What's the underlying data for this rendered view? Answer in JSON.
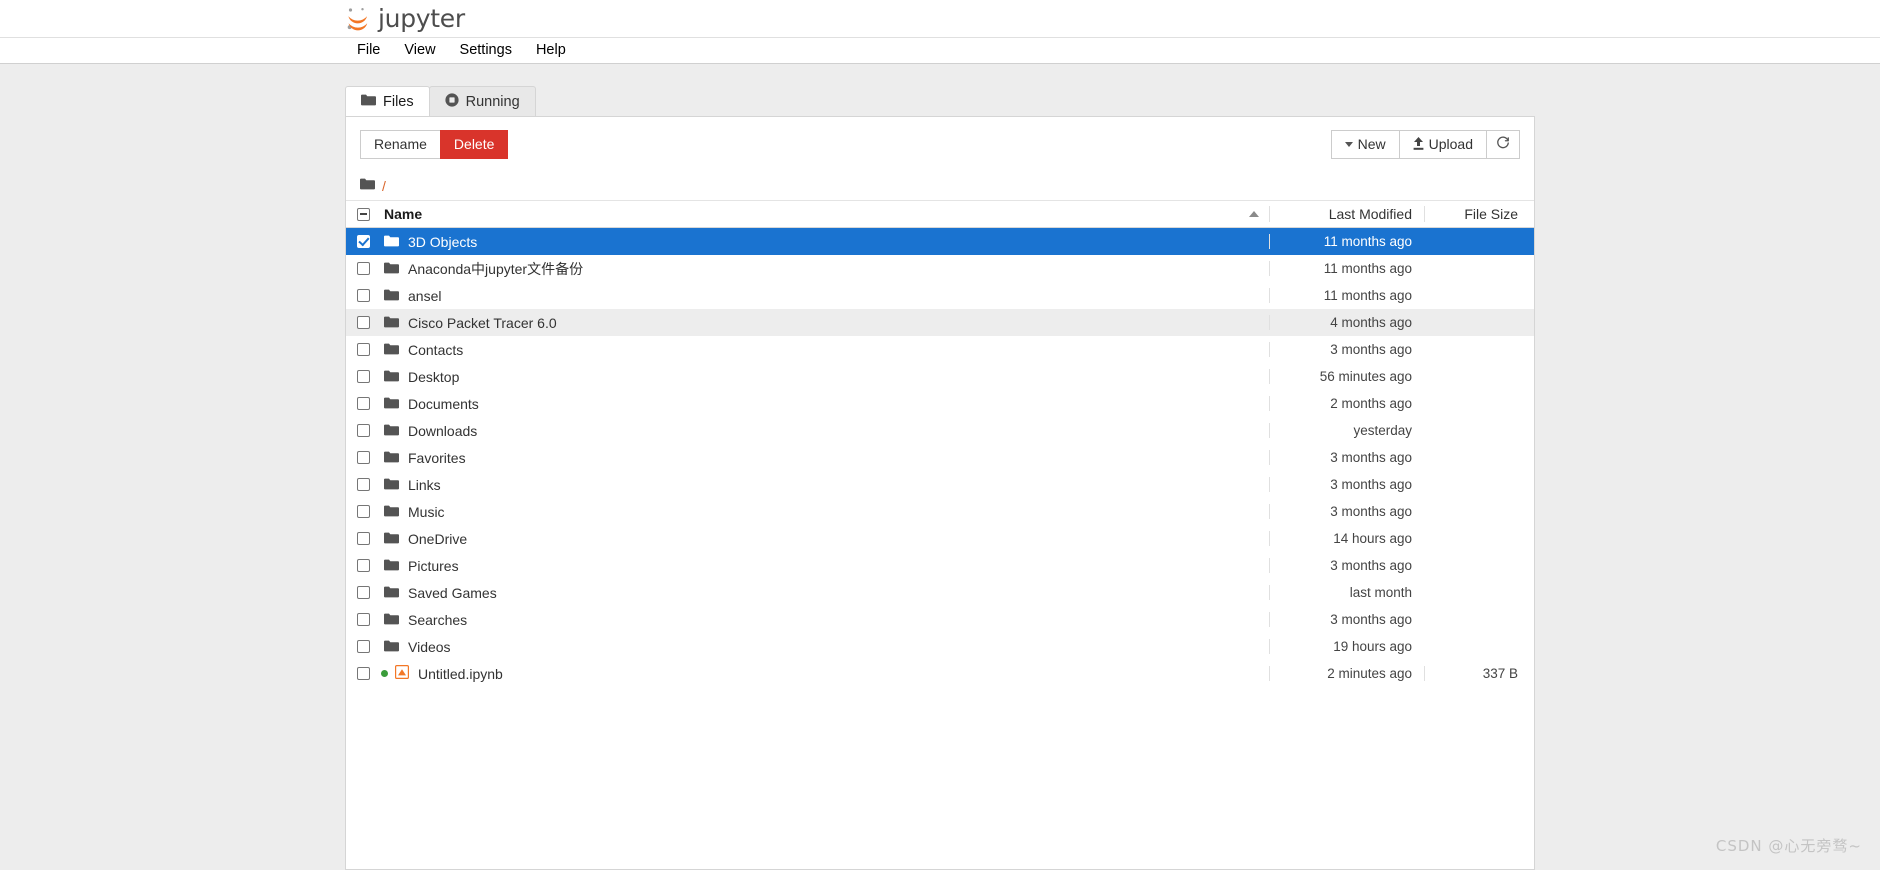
{
  "brand": {
    "name": "jupyter",
    "logo_icon": "jupyter-logo-icon",
    "accent_color": "#f37726"
  },
  "menu": {
    "items": [
      {
        "label": "File"
      },
      {
        "label": "View"
      },
      {
        "label": "Settings"
      },
      {
        "label": "Help"
      }
    ]
  },
  "tabs": [
    {
      "label": "Files",
      "icon": "folder-icon",
      "active": true
    },
    {
      "label": "Running",
      "icon": "running-stop-icon",
      "active": false
    }
  ],
  "toolbar": {
    "rename_label": "Rename",
    "delete_label": "Delete",
    "new_label": "New",
    "upload_label": "Upload",
    "refresh_icon": "refresh-icon",
    "new_caret_icon": "chevron-down-icon",
    "upload_icon": "upload-arrow-icon",
    "delete_color": "#d9342b"
  },
  "breadcrumb": {
    "icon": "folder-icon",
    "path": "/"
  },
  "table": {
    "headers": {
      "name": "Name",
      "last_modified": "Last Modified",
      "file_size": "File Size"
    },
    "sort_icon": "sort-ascending-icon",
    "select_all_state": "indeterminate",
    "selection_color": "#1a73d0",
    "rows": [
      {
        "name": "3D Objects",
        "icon": "folder-icon",
        "modified": "11 months ago",
        "size": "",
        "selected": true,
        "alt": false,
        "running": false
      },
      {
        "name": "Anaconda中jupyter文件备份",
        "icon": "folder-icon",
        "modified": "11 months ago",
        "size": "",
        "selected": false,
        "alt": false,
        "running": false
      },
      {
        "name": "ansel",
        "icon": "folder-icon",
        "modified": "11 months ago",
        "size": "",
        "selected": false,
        "alt": false,
        "running": false
      },
      {
        "name": "Cisco Packet Tracer 6.0",
        "icon": "folder-icon",
        "modified": "4 months ago",
        "size": "",
        "selected": false,
        "alt": true,
        "running": false
      },
      {
        "name": "Contacts",
        "icon": "folder-icon",
        "modified": "3 months ago",
        "size": "",
        "selected": false,
        "alt": false,
        "running": false
      },
      {
        "name": "Desktop",
        "icon": "folder-icon",
        "modified": "56 minutes ago",
        "size": "",
        "selected": false,
        "alt": false,
        "running": false
      },
      {
        "name": "Documents",
        "icon": "folder-icon",
        "modified": "2 months ago",
        "size": "",
        "selected": false,
        "alt": false,
        "running": false
      },
      {
        "name": "Downloads",
        "icon": "folder-icon",
        "modified": "yesterday",
        "size": "",
        "selected": false,
        "alt": false,
        "running": false
      },
      {
        "name": "Favorites",
        "icon": "folder-icon",
        "modified": "3 months ago",
        "size": "",
        "selected": false,
        "alt": false,
        "running": false
      },
      {
        "name": "Links",
        "icon": "folder-icon",
        "modified": "3 months ago",
        "size": "",
        "selected": false,
        "alt": false,
        "running": false
      },
      {
        "name": "Music",
        "icon": "folder-icon",
        "modified": "3 months ago",
        "size": "",
        "selected": false,
        "alt": false,
        "running": false
      },
      {
        "name": "OneDrive",
        "icon": "folder-icon",
        "modified": "14 hours ago",
        "size": "",
        "selected": false,
        "alt": false,
        "running": false
      },
      {
        "name": "Pictures",
        "icon": "folder-icon",
        "modified": "3 months ago",
        "size": "",
        "selected": false,
        "alt": false,
        "running": false
      },
      {
        "name": "Saved Games",
        "icon": "folder-icon",
        "modified": "last month",
        "size": "",
        "selected": false,
        "alt": false,
        "running": false
      },
      {
        "name": "Searches",
        "icon": "folder-icon",
        "modified": "3 months ago",
        "size": "",
        "selected": false,
        "alt": false,
        "running": false
      },
      {
        "name": "Videos",
        "icon": "folder-icon",
        "modified": "19 hours ago",
        "size": "",
        "selected": false,
        "alt": false,
        "running": false
      },
      {
        "name": "Untitled.ipynb",
        "icon": "notebook-icon",
        "modified": "2 minutes ago",
        "size": "337 B",
        "selected": false,
        "alt": false,
        "running": true
      }
    ]
  },
  "watermark": {
    "text": "CSDN @心无旁骛~"
  }
}
